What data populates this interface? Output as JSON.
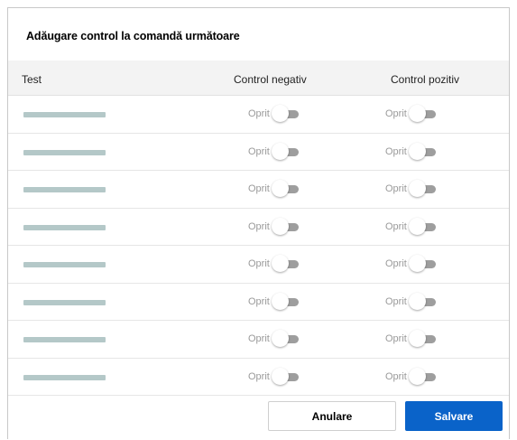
{
  "dialog": {
    "title": "Adăugare control la comandă următoare"
  },
  "table": {
    "columns": [
      "Test",
      "Control negativ",
      "Control pozitiv"
    ],
    "rows": [
      {
        "negative": "Oprit",
        "positive": "Oprit"
      },
      {
        "negative": "Oprit",
        "positive": "Oprit"
      },
      {
        "negative": "Oprit",
        "positive": "Oprit"
      },
      {
        "negative": "Oprit",
        "positive": "Oprit"
      },
      {
        "negative": "Oprit",
        "positive": "Oprit"
      },
      {
        "negative": "Oprit",
        "positive": "Oprit"
      },
      {
        "negative": "Oprit",
        "positive": "Oprit"
      },
      {
        "negative": "Oprit",
        "positive": "Oprit"
      }
    ]
  },
  "footer": {
    "cancel_label": "Anulare",
    "save_label": "Salvare"
  },
  "colors": {
    "primary": "#0a63c9",
    "placeholder": "#b4c8c8",
    "toggle_track_off": "#9e9e9e"
  }
}
